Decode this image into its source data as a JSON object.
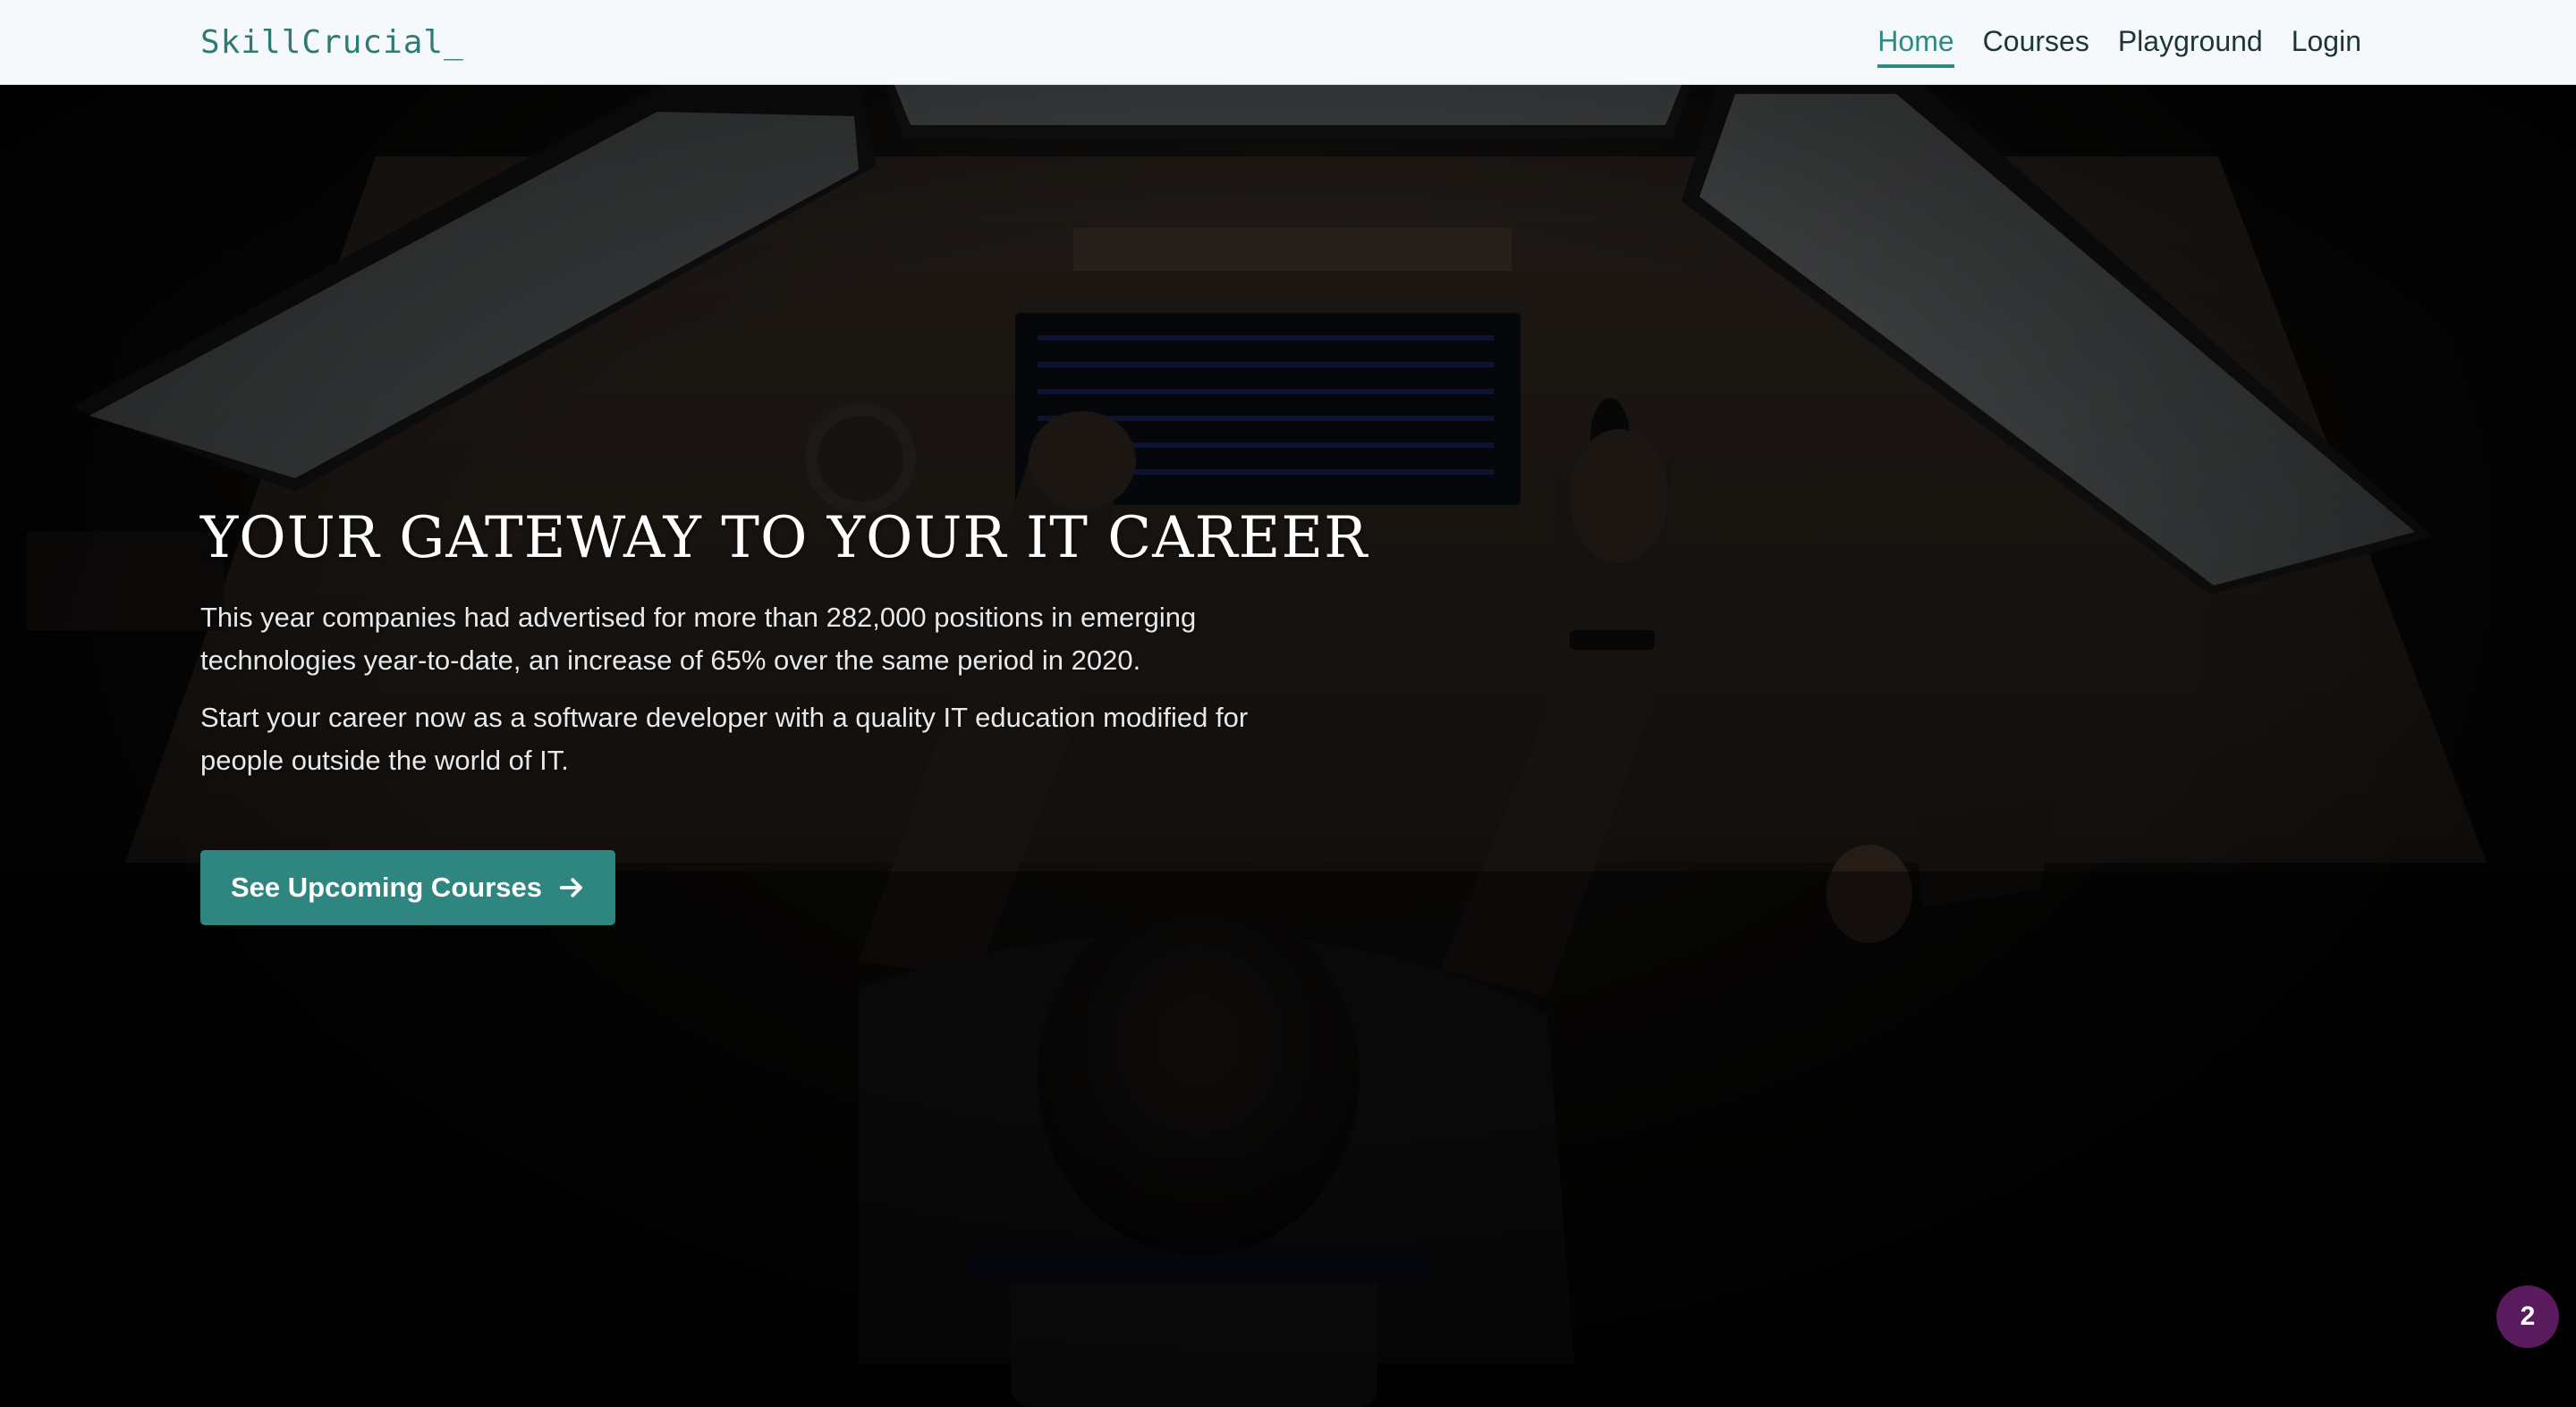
{
  "navbar": {
    "brand": "SkillCrucial_",
    "links": [
      {
        "label": "Home",
        "active": true
      },
      {
        "label": "Courses",
        "active": false
      },
      {
        "label": "Playground",
        "active": false
      },
      {
        "label": "Login",
        "active": false
      }
    ]
  },
  "hero": {
    "title": "YOUR GATEWAY TO YOUR IT CAREER",
    "paragraph_1": "This year companies had advertised for more than 282,000 positions in emerging technologies year-to-date, an increase of 65% over the same period in 2020.",
    "paragraph_2": "Start your career now as a software developer with a quality IT education modified for people outside the world of IT.",
    "cta_label": "See Upcoming Courses",
    "cta_icon": "arrow-right-icon",
    "background_image": "person-at-desk-with-monitors-overhead-photo"
  },
  "badge": {
    "count": "2"
  },
  "colors": {
    "accent": "#2f8580",
    "nav_background": "#f5f9fb",
    "brand": "#2f7a74",
    "badge": "#5a1a5e"
  }
}
